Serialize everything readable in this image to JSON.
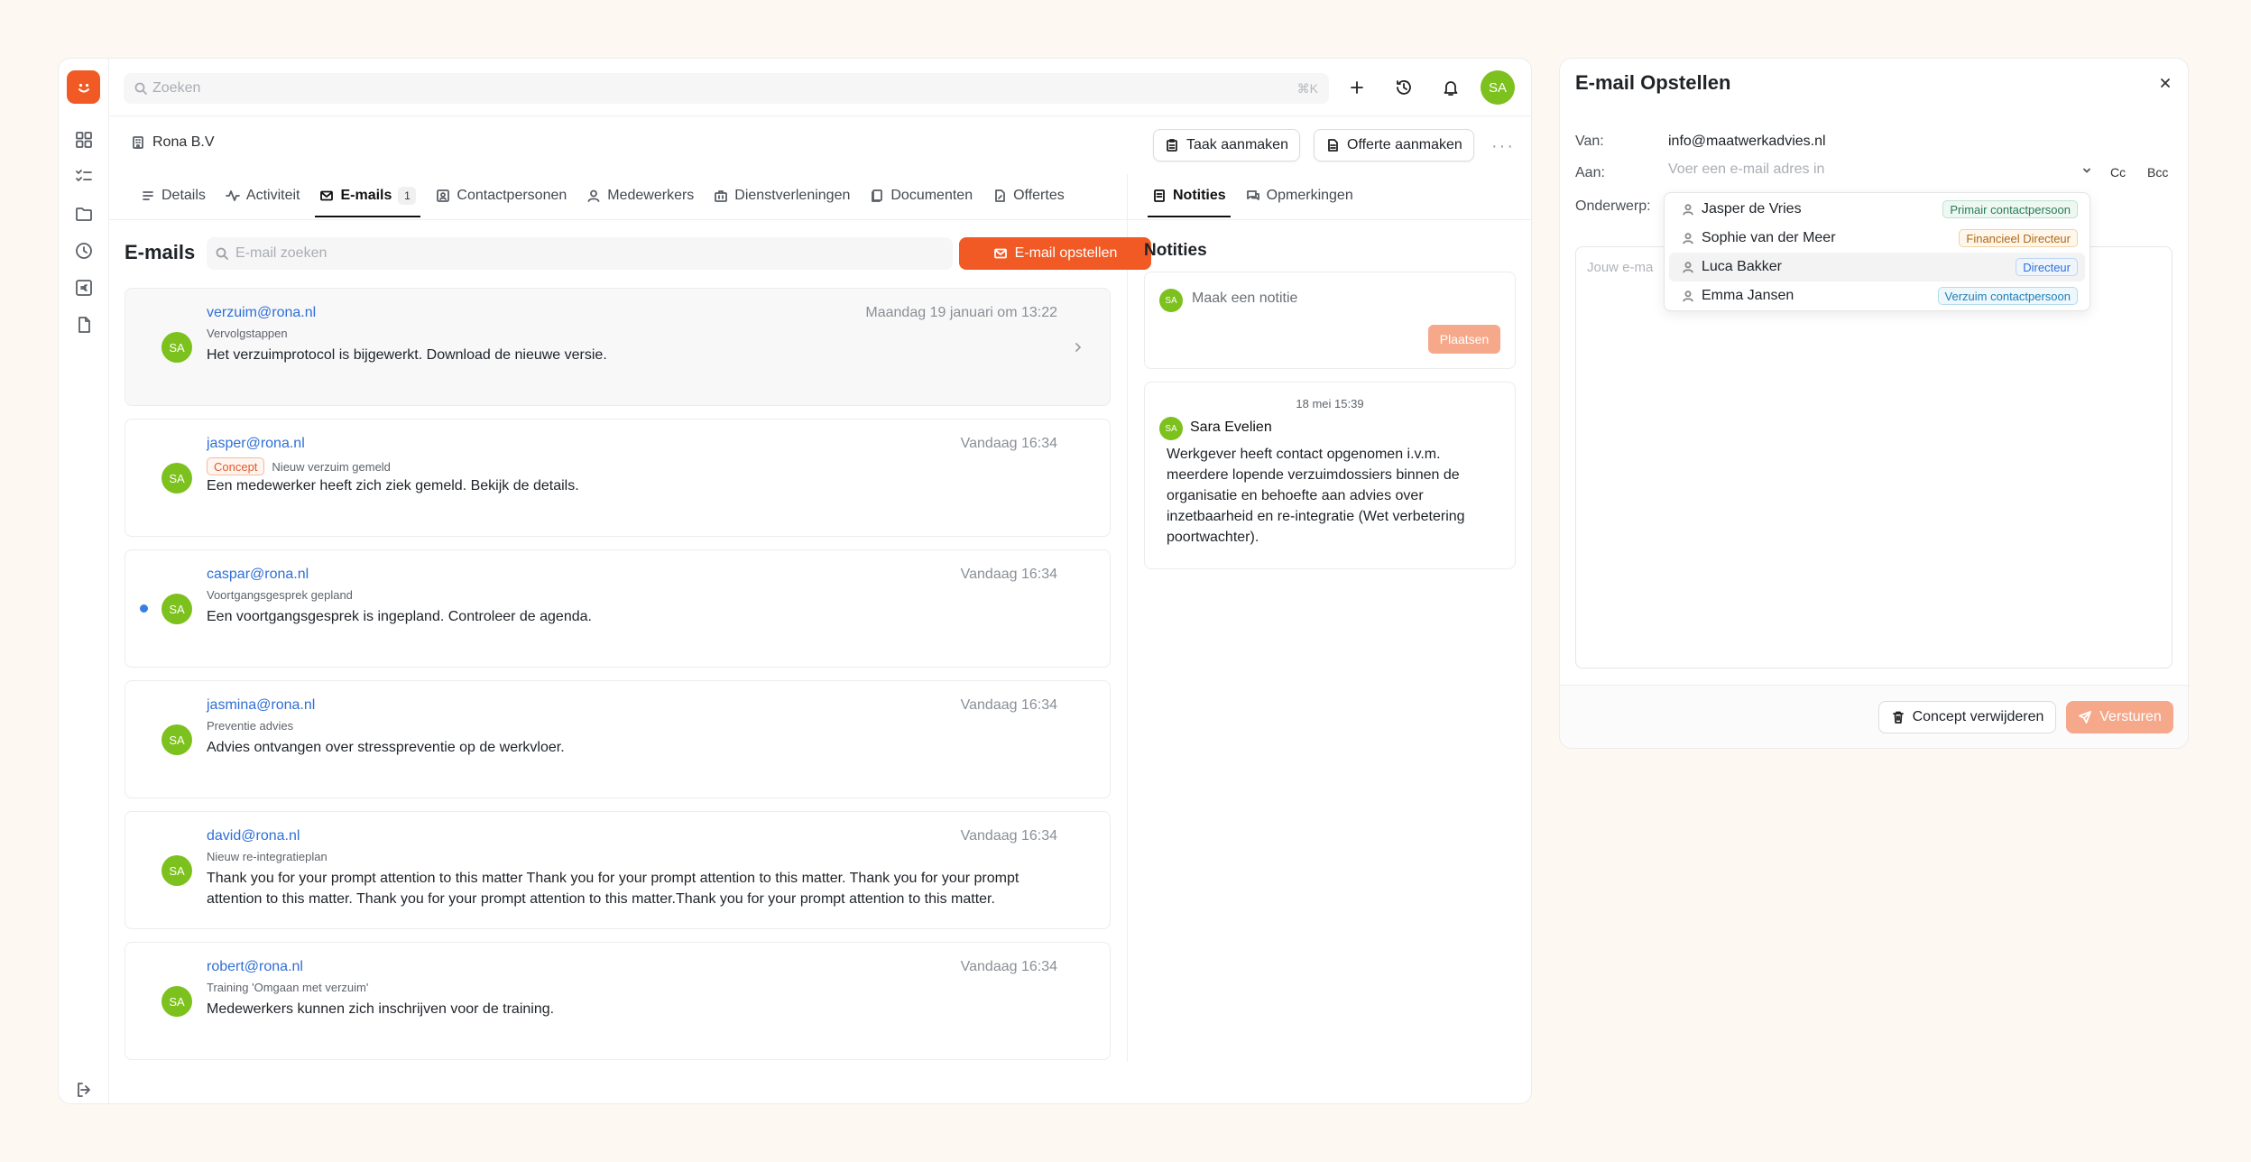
{
  "topbar": {
    "search_placeholder": "Zoeken",
    "shortcut": "⌘K",
    "avatar": "SA"
  },
  "header": {
    "company": "Rona B.V",
    "task_button": "Taak aanmaken",
    "quote_button": "Offerte aanmaken",
    "more": "···"
  },
  "tabs": [
    {
      "label": "Details",
      "icon": "list-icon"
    },
    {
      "label": "Activiteit",
      "icon": "activity-icon"
    },
    {
      "label": "E-mails",
      "icon": "mail-icon",
      "count": "1",
      "active": true
    },
    {
      "label": "Contactpersonen",
      "icon": "contact-card-icon"
    },
    {
      "label": "Medewerkers",
      "icon": "user-icon"
    },
    {
      "label": "Dienstverleningen",
      "icon": "briefcase-icon"
    },
    {
      "label": "Documenten",
      "icon": "documents-icon"
    },
    {
      "label": "Offertes",
      "icon": "quote-icon"
    }
  ],
  "emails": {
    "title": "E-mails",
    "search_placeholder": "E-mail zoeken",
    "compose_label": "E-mail opstellen",
    "items": [
      {
        "from": "verzuim@rona.nl",
        "date": "Maandag 19 januari om 13:22",
        "subject": "Vervolgstappen",
        "badge": "",
        "body": "Het verzuimprotocol is bijgewerkt. Download de nieuwe versie.",
        "avatar": "SA",
        "unread": false
      },
      {
        "from": "jasper@rona.nl",
        "date": "Vandaag 16:34",
        "subject": "Nieuw verzuim gemeld",
        "badge": "Concept",
        "body": "Een medewerker heeft zich ziek gemeld. Bekijk de details.",
        "avatar": "SA",
        "unread": false
      },
      {
        "from": "caspar@rona.nl",
        "date": "Vandaag 16:34",
        "subject": "Voortgangsgesprek gepland",
        "badge": "",
        "body": "Een voortgangsgesprek is ingepland. Controleer de agenda.",
        "avatar": "SA",
        "unread": true
      },
      {
        "from": "jasmina@rona.nl",
        "date": "Vandaag 16:34",
        "subject": "Preventie advies",
        "badge": "",
        "body": "Advies ontvangen over stresspreventie op de werkvloer.",
        "avatar": "SA",
        "unread": false
      },
      {
        "from": "david@rona.nl",
        "date": "Vandaag 16:34",
        "subject": "Nieuw re-integratieplan",
        "badge": "",
        "body": "Thank you for your prompt attention to this matter Thank you for your prompt attention to this matter. Thank you for your prompt attention to this matter. Thank you for your prompt attention to this matter.Thank you for your prompt attention to this matter.",
        "avatar": "SA",
        "unread": false
      },
      {
        "from": "robert@rona.nl",
        "date": "Vandaag 16:34",
        "subject": "Training 'Omgaan met verzuim'",
        "badge": "",
        "body": "Medewerkers kunnen zich inschrijven voor de training.",
        "avatar": "SA",
        "unread": false
      }
    ]
  },
  "notes": {
    "tab_notes": "Notities",
    "tab_remarks": "Opmerkingen",
    "title": "Notities",
    "new_placeholder": "Maak een notitie",
    "post_label": "Plaatsen",
    "avatar": "SA",
    "entry": {
      "date": "18 mei 15:39",
      "author": "Sara Evelien",
      "text": "Werkgever heeft contact opgenomen i.v.m. meerdere lopende verzuimdossiers binnen de organisatie en behoefte aan advies over inzetbaarheid en re-integratie (Wet verbetering poortwachter)."
    }
  },
  "compose": {
    "title": "E-mail Opstellen",
    "from_label": "Van:",
    "from_value": "info@maatwerkadvies.nl",
    "to_label": "Aan:",
    "to_placeholder": "Voer een e-mail adres in",
    "cc": "Cc",
    "bcc": "Bcc",
    "subject_label": "Onderwerp:",
    "body_placeholder": "Jouw e-ma",
    "delete_draft": "Concept verwijderen",
    "send": "Versturen",
    "suggestions": [
      {
        "name": "Jasper de Vries",
        "role": "Primair contactpersoon"
      },
      {
        "name": "Sophie van der Meer",
        "role": "Financieel Directeur"
      },
      {
        "name": "Luca Bakker",
        "role": "Directeur"
      },
      {
        "name": "Emma Jansen",
        "role": "Verzuim contactpersoon"
      }
    ]
  },
  "colors": {
    "accent": "#f15a24",
    "accent_disabled": "#f6a88a",
    "avatar_green": "#7cc11d",
    "link_blue": "#2f6fd6"
  }
}
